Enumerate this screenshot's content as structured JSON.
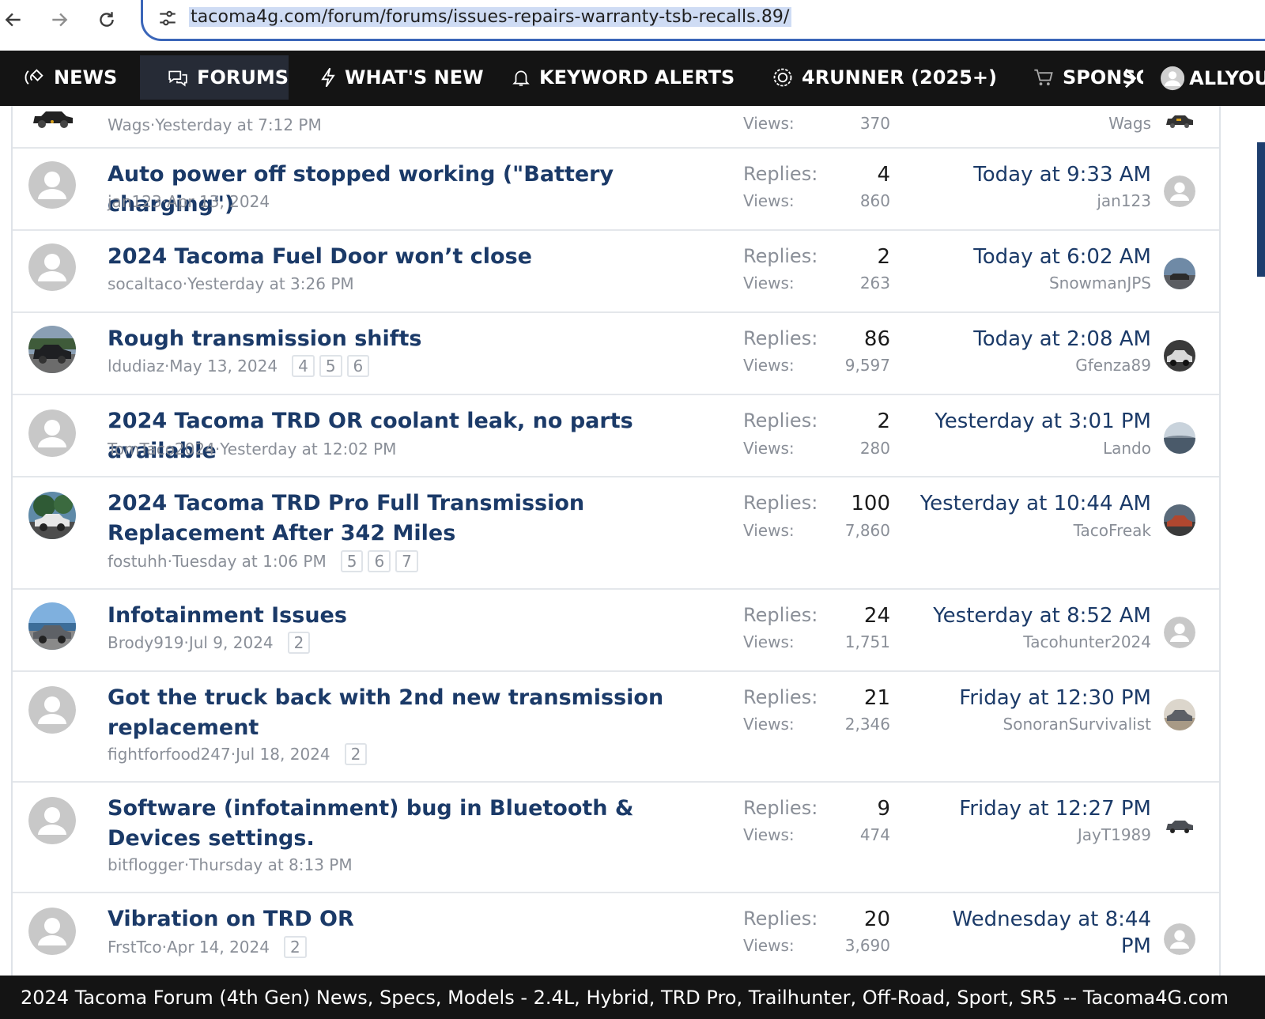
{
  "browser": {
    "url": "tacoma4g.com/forum/forums/issues-repairs-warranty-tsb-recalls.89/"
  },
  "nav": {
    "items": [
      {
        "label": "NEWS",
        "icon": "satellite-icon"
      },
      {
        "label": "FORUMS",
        "icon": "chat-bubbles-icon"
      },
      {
        "label": "WHAT'S NEW",
        "icon": "lightning-icon"
      },
      {
        "label": "KEYWORD ALERTS",
        "icon": "bell-icon"
      },
      {
        "label": "4RUNNER (2025+)",
        "icon": "badge-icon"
      },
      {
        "label": "SPONSO",
        "icon": "cart-icon"
      }
    ],
    "user": "ALLYOU"
  },
  "threads": [
    {
      "title": "",
      "author": "Wags",
      "date": "Yesterday at 7:12 PM",
      "pages": [],
      "replies": "",
      "views": "370",
      "last_date": "",
      "last_user": "Wags"
    },
    {
      "title": "Auto power off stopped working (\"Battery charging\")",
      "author": "jan123",
      "date": "Apr 13, 2024",
      "pages": [],
      "replies": "4",
      "views": "860",
      "last_date": "Today at 9:33 AM",
      "last_user": "jan123"
    },
    {
      "title": "2024 Tacoma Fuel Door won’t close",
      "author": "socaltaco",
      "date": "Yesterday at 3:26 PM",
      "pages": [],
      "replies": "2",
      "views": "263",
      "last_date": "Today at 6:02 AM",
      "last_user": "SnowmanJPS"
    },
    {
      "title": "Rough transmission shifts",
      "author": "ldudiaz",
      "date": "May 13, 2024",
      "pages": [
        "4",
        "5",
        "6"
      ],
      "replies": "86",
      "views": "9,597",
      "last_date": "Today at 2:08 AM",
      "last_user": "Gfenza89"
    },
    {
      "title": "2024 Tacoma TRD OR coolant leak, no parts available",
      "author": "TomTaco2024",
      "date": "Yesterday at 12:02 PM",
      "pages": [],
      "replies": "2",
      "views": "280",
      "last_date": "Yesterday at 3:01 PM",
      "last_user": "Lando"
    },
    {
      "title": "2024 Tacoma TRD Pro Full Transmission Replacement After 342 Miles",
      "author": "fostuhh",
      "date": "Tuesday at 1:06 PM",
      "pages": [
        "5",
        "6",
        "7"
      ],
      "replies": "100",
      "views": "7,860",
      "last_date": "Yesterday at 10:44 AM",
      "last_user": "TacoFreak"
    },
    {
      "title": "Infotainment Issues",
      "author": "Brody919",
      "date": "Jul 9, 2024",
      "pages": [
        "2"
      ],
      "replies": "24",
      "views": "1,751",
      "last_date": "Yesterday at 8:52 AM",
      "last_user": "Tacohunter2024"
    },
    {
      "title": "Got the truck back with 2nd new transmission replacement",
      "author": "fightforfood247",
      "date": "Jul 18, 2024",
      "pages": [
        "2"
      ],
      "replies": "21",
      "views": "2,346",
      "last_date": "Friday at 12:30 PM",
      "last_user": "SonoranSurvivalist"
    },
    {
      "title": "Software (infotainment) bug in Bluetooth & Devices settings.",
      "author": "bitflogger",
      "date": "Thursday at 8:13 PM",
      "pages": [],
      "replies": "9",
      "views": "474",
      "last_date": "Friday at 12:27 PM",
      "last_user": "JayT1989"
    },
    {
      "title": "Vibration on TRD OR",
      "author": "FrstTco",
      "date": "Apr 14, 2024",
      "pages": [
        "2"
      ],
      "replies": "20",
      "views": "3,690",
      "last_date": "Wednesday at 8:44 PM",
      "last_user": ""
    }
  ],
  "labels": {
    "replies": "Replies:",
    "views": "Views:",
    "separator": " · "
  },
  "footer": {
    "text": "2024 Tacoma Forum (4th Gen) News, Specs, Models - 2.4L, Hybrid, TRD Pro, Trailhunter, Off-Road, Sport, SR5 -- Tacoma4G.com"
  },
  "colors": {
    "nav_bg": "#141414",
    "title_blue": "#1b3a68",
    "muted": "#8a8f98",
    "url_highlight": "#cfdcf4"
  }
}
